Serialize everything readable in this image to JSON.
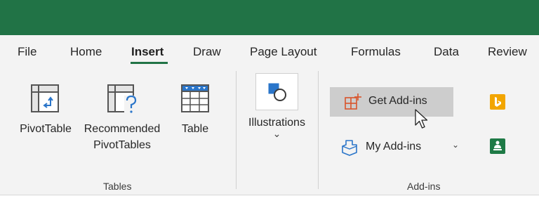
{
  "ribbon_tabs": [
    {
      "label": "File"
    },
    {
      "label": "Home"
    },
    {
      "label": "Insert",
      "active": true
    },
    {
      "label": "Draw"
    },
    {
      "label": "Page Layout"
    },
    {
      "label": "Formulas"
    },
    {
      "label": "Data"
    },
    {
      "label": "Review"
    }
  ],
  "tables_group": {
    "label": "Tables",
    "pivot_table": "PivotTable",
    "recommended_line1": "Recommended",
    "recommended_line2": "PivotTables",
    "table": "Table"
  },
  "illustrations": {
    "label": "Illustrations",
    "chevron": "⌄"
  },
  "addins_group": {
    "label": "Add-ins",
    "get_addins": "Get Add-ins",
    "my_addins": "My Add-ins",
    "my_addins_chevron": "⌄"
  },
  "colors": {
    "title_bar": "#217346",
    "accent": "#217346",
    "bing_orange": "#f2a500",
    "people_green": "#1e7a46",
    "addins_red": "#d9542b",
    "illustrations_blue": "#2a75c9"
  }
}
